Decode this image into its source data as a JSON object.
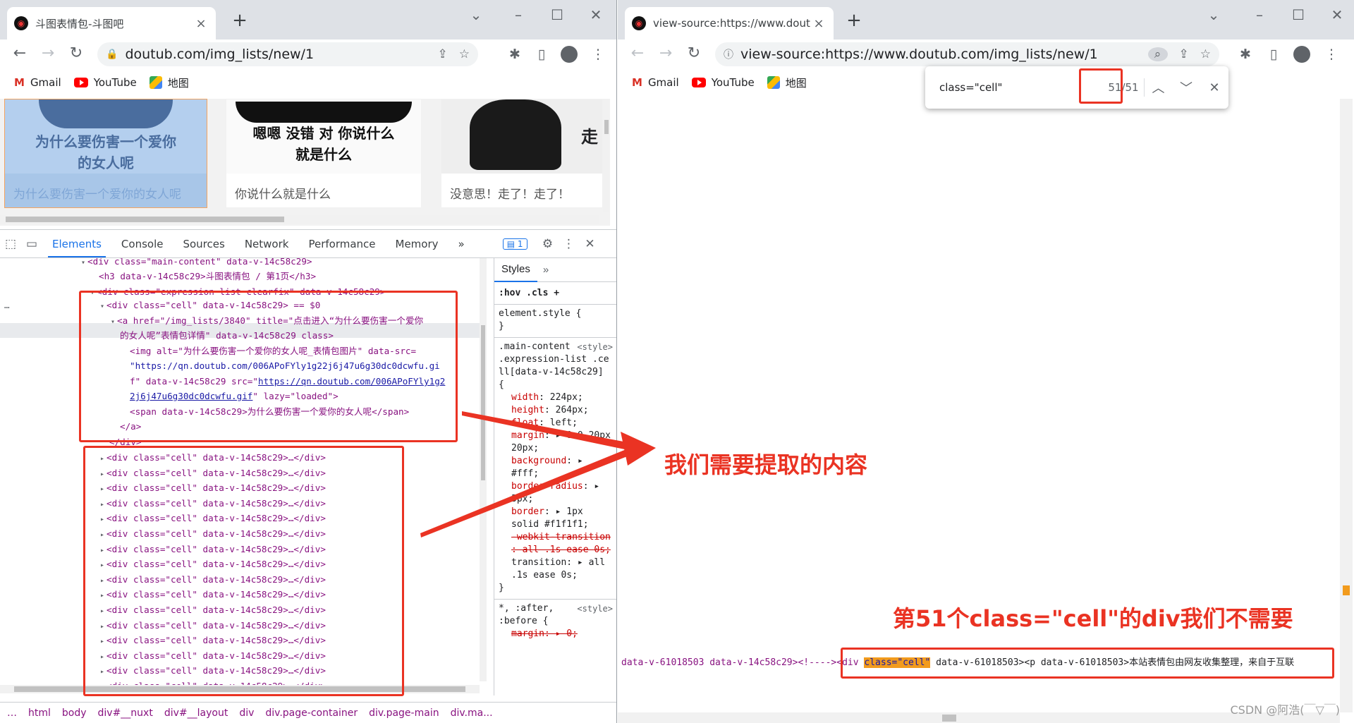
{
  "left_window": {
    "tab_title": "斗图表情包-斗图吧",
    "url": "doutub.com/img_lists/new/1",
    "bookmarks": [
      "Gmail",
      "YouTube",
      "地图"
    ],
    "cards": [
      {
        "image_text": "为什么要伤害一个爱你的女人呢",
        "caption": "为什么要伤害一个爱你的女人呢"
      },
      {
        "image_text": "嗯嗯 没错 对 你说什么就是什么",
        "caption": "你说什么就是什么"
      },
      {
        "image_text": "走",
        "caption": "没意思！走了！走了！"
      }
    ]
  },
  "devtools": {
    "tabs": [
      "Elements",
      "Console",
      "Sources",
      "Network",
      "Performance",
      "Memory"
    ],
    "more": "»",
    "issues_badge": "1",
    "lines": [
      "<div class=\"main-content\" data-v-14c58c29>",
      "<h3 data-v-14c58c29>斗图表情包 / 第1页</h3>",
      "<div class=\"expression-list clearfix\" data-v-14c58c29>"
    ],
    "selected_line": "<div class=\"cell\" data-v-14c58c29> == $0",
    "anchor_line_1": "<a href=\"/img_lists/3840\" title=\"点击进入“为什么要伤害一个爱你",
    "anchor_line_2": "的女人呢”表情包详情\" data-v-14c58c29 class>",
    "img_line_1": "<img alt=\"为什么要伤害一个爱你的女人呢_表情包图片\" data-src=",
    "img_line_2": "\"https://qn.doutub.com/006APoFYly1g22j6j47u6g30dc0dcwfu.gi",
    "img_line_3a": "f\" data-v-14c58c29 src=\"",
    "img_line_3b": "https://qn.doutub.com/006APoFYly1g2",
    "img_line_4a": "2j6j47u6g30dc0dcwfu.gif",
    "img_line_4b": "\" lazy=\"loaded\">",
    "span_line": "<span data-v-14c58c29>为什么要伤害一个爱你的女人呢</span>",
    "close_a": "</a>",
    "close_div": "</div>",
    "collapsed_cell": "<div class=\"cell\" data-v-14c58c29>…</div>",
    "styles_tab": "Styles",
    "styles_filter": ":hov  .cls  +",
    "element_style": "element.style {",
    "rule_selector": ".main-content .expression-list .cell[data-v-14c58c29] {",
    "rule_source": "<style>",
    "props": [
      {
        "n": "width",
        "v": "224px;"
      },
      {
        "n": "height",
        "v": "264px;"
      },
      {
        "n": "float",
        "v": "left;"
      },
      {
        "n": "margin",
        "v": "▸ 0 0 20px 20px;"
      },
      {
        "n": "background",
        "v": "▸ #fff;"
      },
      {
        "n": "border-radius",
        "v": "▸ 3px;"
      },
      {
        "n": "border",
        "v": "▸ 1px solid #f1f1f1;"
      }
    ],
    "strike_props": "-webkit-transition : all .1s ease 0s;",
    "transition": "transition: ▸ all .1s ease 0s;",
    "after_rule": "*, :after, :before {",
    "after_prop": "margin: ▸ 0;",
    "breadcrumbs": [
      "html",
      "body",
      "div#__nuxt",
      "div#__layout",
      "div",
      "div.page-container",
      "div.page-main",
      "div.ma..."
    ]
  },
  "right_window": {
    "tab_title": "view-source:https://www.dout",
    "url": "view-source:https://www.doutub.com/img_lists/new/1",
    "bookmarks": [
      "Gmail",
      "YouTube",
      "地图"
    ],
    "find_query": "class=\"cell\"",
    "find_count": "51/51",
    "source_pre": "data-v-61018503 data-v-14c58c29><!---->",
    "source_div": "<div ",
    "source_hl": "class=\"cell\"",
    "source_post": " data-v-61018503><p data-v-61018503>本站表情包由网友收集整理，来自于互联"
  },
  "annotations": {
    "extract": "我们需要提取的内容",
    "not_needed": "第51个class=\"cell\"的div我们不需要",
    "watermark": "CSDN @阿浩(￣▽￣)"
  },
  "colors": {
    "annotation_red": "#ea3323",
    "highlight": "#f29b1d",
    "link_blue": "#1a73e8"
  }
}
